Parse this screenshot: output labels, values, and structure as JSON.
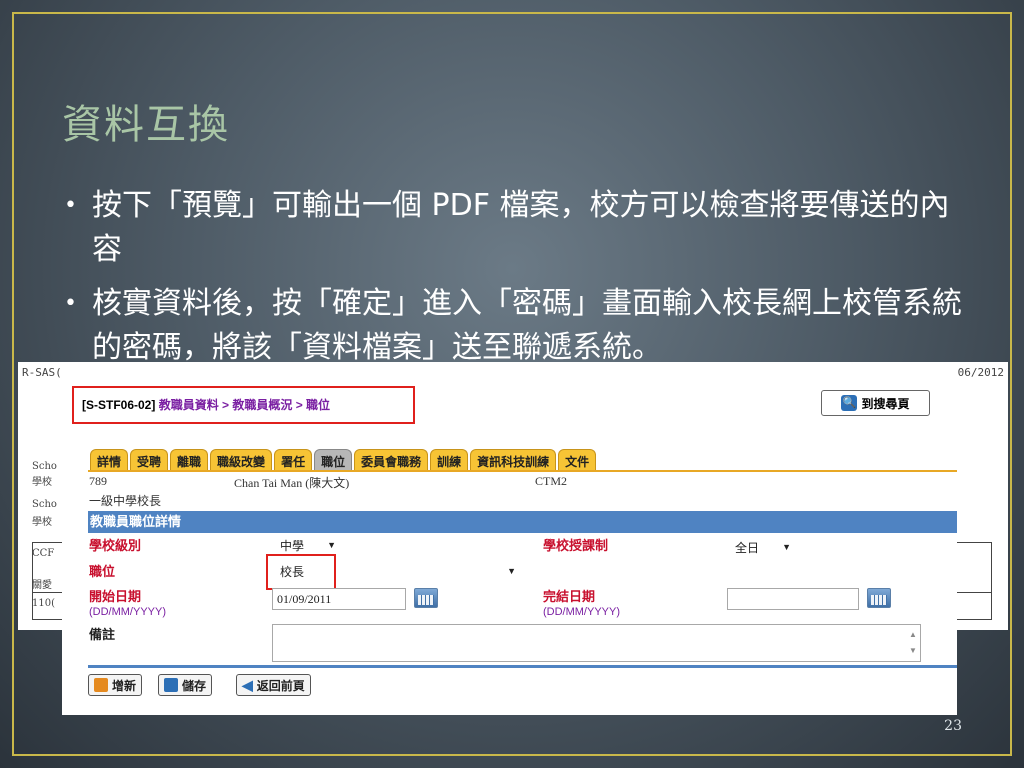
{
  "slide": {
    "title": "資料互換",
    "bullets": [
      "按下「預覽」可輸出一個 PDF 檔案，校方可以檢查將要傳送的內容",
      "核實資料後，按「確定」進入「密碼」畫面輸入校長網上校管系統的密碼，將該「資料檔案」送至聯遞系統。"
    ],
    "page_number": "23"
  },
  "background_shot": {
    "top_left": "R-SAS(",
    "top_right": "06/2012",
    "side_labels": [
      "Scho",
      "學校",
      "Scho",
      "學校",
      "CCF",
      "關愛",
      "110("
    ]
  },
  "screen": {
    "breadcrumb": {
      "code": "[S-STF06-02]",
      "path": "教職員資料 > 教職員概況 > 職位"
    },
    "search_button": "到搜尋頁",
    "tabs": [
      "詳情",
      "受聘",
      "離職",
      "職級改變",
      "署任",
      "職位",
      "委員會職務",
      "訓練",
      "資訊科技訓練",
      "文件"
    ],
    "active_tab": "職位",
    "staff": {
      "id": "789",
      "name": "Chan Tai Man (陳大文)",
      "code": "CTM2",
      "rank": "一級中學校長"
    },
    "section_title": "教職員職位詳情",
    "fields": {
      "school_level_label": "學校級別",
      "school_level_value": "中學",
      "session_label": "學校授課制",
      "session_value": "全日",
      "post_label": "職位",
      "post_value": "校長",
      "start_label": "開始日期",
      "start_hint": "(DD/MM/YYYY)",
      "start_value": "01/09/2011",
      "end_label": "完結日期",
      "end_hint": "(DD/MM/YYYY)",
      "end_value": "",
      "remarks_label": "備註"
    },
    "buttons": {
      "add": "增新",
      "save": "儲存",
      "back": "返回前頁"
    }
  },
  "colors": {
    "frame": "#c9b84a",
    "title": "#a9c6a6",
    "tab": "#f7c435",
    "section_bar": "#4f83c2",
    "highlight": "#e0201c",
    "label_red": "#c8102e",
    "breadcrumb_purple": "#7a1fa2"
  }
}
